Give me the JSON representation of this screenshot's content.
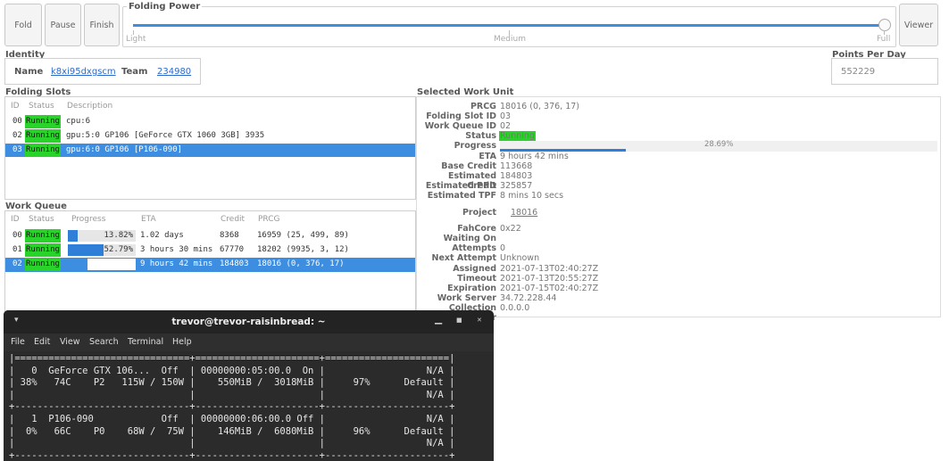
{
  "toolbar": {
    "fold": "Fold",
    "pause": "Pause",
    "finish": "Finish",
    "viewer": "Viewer"
  },
  "folding_power": {
    "legend": "Folding Power",
    "light": "Light",
    "medium": "Medium",
    "full": "Full",
    "level_percent": 100
  },
  "identity": {
    "legend": "Identity",
    "name_label": "Name",
    "name_value": "k8xi95dxgscm",
    "team_label": "Team",
    "team_value": "234980"
  },
  "ppd": {
    "legend": "Points Per Day",
    "value": "552229"
  },
  "slots": {
    "legend": "Folding Slots",
    "headers": {
      "id": "ID",
      "status": "Status",
      "description": "Description"
    },
    "rows": [
      {
        "id": "00",
        "status": "Running",
        "description": "cpu:6",
        "selected": false
      },
      {
        "id": "02",
        "status": "Running",
        "description": "gpu:5:0 GP106 [GeForce GTX 1060 3GB] 3935",
        "selected": false
      },
      {
        "id": "03",
        "status": "Running",
        "description": "gpu:6:0 GP106 [P106-090]",
        "selected": true
      }
    ]
  },
  "queue": {
    "legend": "Work Queue",
    "headers": {
      "id": "ID",
      "status": "Status",
      "progress": "Progress",
      "eta": "ETA",
      "credit": "Credit",
      "prcg": "PRCG"
    },
    "rows": [
      {
        "id": "00",
        "status": "Running",
        "progress": "13.82%",
        "progress_value": 13.82,
        "eta": "1.02 days",
        "credit": "8368",
        "prcg": "16959 (25, 499, 89)",
        "selected": false
      },
      {
        "id": "01",
        "status": "Running",
        "progress": "52.79%",
        "progress_value": 52.79,
        "eta": "3 hours 30 mins",
        "credit": "67770",
        "prcg": "18202 (9935, 3, 12)",
        "selected": false
      },
      {
        "id": "02",
        "status": "Running",
        "progress": "28.69%",
        "progress_value": 28.69,
        "eta": "9 hours 42 mins",
        "credit": "184803",
        "prcg": "18016 (0, 376, 17)",
        "selected": true
      }
    ]
  },
  "work_unit": {
    "legend": "Selected Work Unit",
    "prcg_label": "PRCG",
    "prcg": "18016 (0, 376, 17)",
    "slot_label": "Folding Slot ID",
    "slot": "03",
    "queue_label": "Work Queue ID",
    "queue": "02",
    "status_label": "Status",
    "status": "Running",
    "progress_label": "Progress",
    "progress": "28.69%",
    "progress_value": 28.69,
    "eta_label": "ETA",
    "eta": "9 hours 42 mins",
    "base_credit_label": "Base Credit",
    "base_credit": "113668",
    "est_credit_label": "Estimated Credit",
    "est_credit": "184803",
    "est_ppd_label": "Estimated PPD",
    "est_ppd": "325857",
    "est_tpf_label": "Estimated TPF",
    "est_tpf": "8 mins 10 secs",
    "project_label": "Project",
    "project": "18016",
    "fahcore_label": "FahCore",
    "fahcore": "0x22",
    "waiting_label": "Waiting On",
    "waiting": "",
    "attempts_label": "Attempts",
    "attempts": "0",
    "next_attempt_label": "Next Attempt",
    "next_attempt": "Unknown",
    "assigned_label": "Assigned",
    "assigned": "2021-07-13T02:40:27Z",
    "timeout_label": "Timeout",
    "timeout": "2021-07-13T20:55:27Z",
    "expiration_label": "Expiration",
    "expiration": "2021-07-15T02:40:27Z",
    "work_server_label": "Work Server",
    "work_server": "34.72.228.44",
    "collection_label": "Collection Server",
    "collection": "0.0.0.0"
  },
  "terminal": {
    "title": "trevor@trevor-raisinbread: ~",
    "menu": [
      "File",
      "Edit",
      "View",
      "Search",
      "Terminal",
      "Help"
    ],
    "lines": [
      "|===============================+======================+======================|",
      "|   0  GeForce GTX 106...  Off  | 00000000:05:00.0  On |                  N/A |",
      "| 38%   74C    P2   115W / 150W |    550MiB /  3018MiB |     97%      Default |",
      "|                               |                      |                  N/A |",
      "+-------------------------------+----------------------+----------------------+",
      "|   1  P106-090            Off  | 00000000:06:00.0 Off |                  N/A |",
      "|  0%   66C    P0    68W /  75W |    146MiB /  6080MiB |     96%      Default |",
      "|                               |                      |                  N/A |",
      "+-------------------------------+----------------------+----------------------+"
    ]
  },
  "colors": {
    "running": "#2ad32a",
    "selection": "#3d8ee0",
    "progress": "#2f7fd8"
  }
}
